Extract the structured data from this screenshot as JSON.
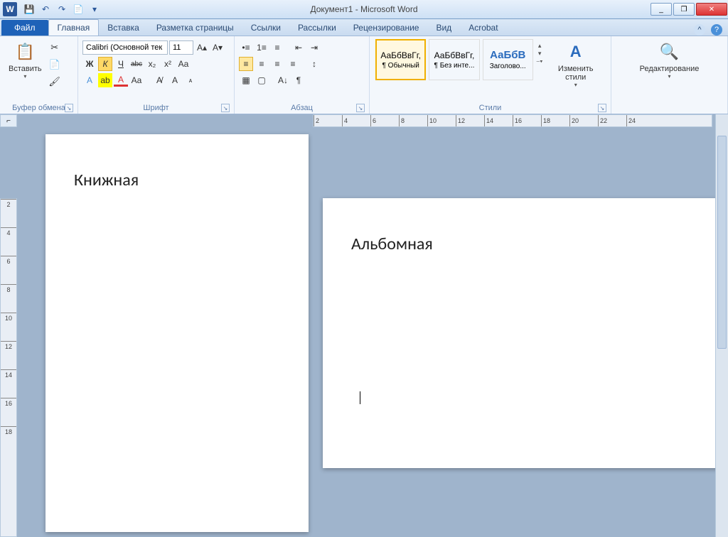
{
  "app": {
    "title": "Документ1 - Microsoft Word",
    "word_icon": "W"
  },
  "qat": {
    "save": "💾",
    "undo": "↶",
    "redo": "↷",
    "more": "▾",
    "new": "📄"
  },
  "window_controls": {
    "min": "_",
    "max": "❐",
    "close": "✕"
  },
  "tabs": {
    "file": "Файл",
    "items": [
      {
        "label": "Главная",
        "active": true
      },
      {
        "label": "Вставка",
        "active": false
      },
      {
        "label": "Разметка страницы",
        "active": false
      },
      {
        "label": "Ссылки",
        "active": false
      },
      {
        "label": "Рассылки",
        "active": false
      },
      {
        "label": "Рецензирование",
        "active": false
      },
      {
        "label": "Вид",
        "active": false
      },
      {
        "label": "Acrobat",
        "active": false
      }
    ],
    "minimize_ribbon": "^",
    "help": "?"
  },
  "ribbon": {
    "clipboard": {
      "label": "Буфер обмена",
      "paste": "Вставить",
      "paste_icon": "📋",
      "cut": "✂",
      "copy": "📄",
      "format_painter": "🖌"
    },
    "font": {
      "label": "Шрифт",
      "name": "Calibri (Основной тек",
      "size": "11",
      "grow": "A▴",
      "shrink": "A▾",
      "bold": "Ж",
      "italic": "К",
      "underline": "Ч",
      "strike": "abc",
      "sub": "x₂",
      "sup": "x²",
      "effects": "Aa",
      "highlight": "ab",
      "color": "A",
      "change_case": "Aa",
      "clear": "A̸",
      "grow2": "A",
      "shrink2": "ᴀ"
    },
    "paragraph": {
      "label": "Абзац",
      "bullets": "•≡",
      "numbering": "1≡",
      "multilevel": "≡",
      "dedent": "⇤",
      "indent": "⇥",
      "sort": "A↓",
      "marks": "¶",
      "align_l": "≡",
      "align_c": "≡",
      "align_r": "≡",
      "justify": "≡",
      "spacing": "↕",
      "shading": "▦",
      "borders": "▢"
    },
    "styles": {
      "label": "Стили",
      "items": [
        {
          "sample": "АаБбВвГг,",
          "name": "¶ Обычный",
          "selected": true
        },
        {
          "sample": "АаБбВвГг,",
          "name": "¶ Без инте...",
          "selected": false
        },
        {
          "sample": "АаБбВ",
          "name": "Заголово...",
          "selected": false
        }
      ],
      "change": "Изменить стили",
      "change_icon": "A"
    },
    "editing": {
      "label": "Редактирование",
      "icon": "🔍"
    }
  },
  "ruler": {
    "h_ticks": [
      "2",
      "4",
      "6",
      "8",
      "10",
      "12",
      "14",
      "16",
      "18",
      "20",
      "22",
      "24"
    ],
    "v_ticks": [
      "2",
      "4",
      "6",
      "8",
      "10",
      "12",
      "14",
      "16",
      "18"
    ]
  },
  "document": {
    "page1_text": "Книжная",
    "page2_text": "Альбомная"
  },
  "corner": "⌐"
}
